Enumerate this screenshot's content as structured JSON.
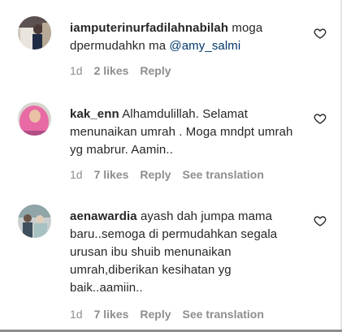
{
  "comments": [
    {
      "username": "iamputerinurfadilahnabilah",
      "text": " moga dpermudahkn ma ",
      "mention": "@amy_salmi",
      "time": "1d",
      "likes": "2 likes",
      "reply": "Reply"
    },
    {
      "username": "kak_enn",
      "text": " Alhamdulillah. Selamat menunaikan umrah . Moga mndpt umrah yg mabrur. Aamin..",
      "time": "1d",
      "likes": "7 likes",
      "reply": "Reply",
      "translate": "See translation"
    },
    {
      "username": "aenawardia",
      "text": " ayash dah jumpa mama baru..semoga di permudahkan segala urusan ibu shuib menunaikan umrah,diberikan kesihatan yg baik..aamiin..",
      "time": "1d",
      "likes": "7 likes",
      "reply": "Reply",
      "translate": "See translation"
    }
  ],
  "icons": {
    "like": "heart-outline-icon"
  }
}
